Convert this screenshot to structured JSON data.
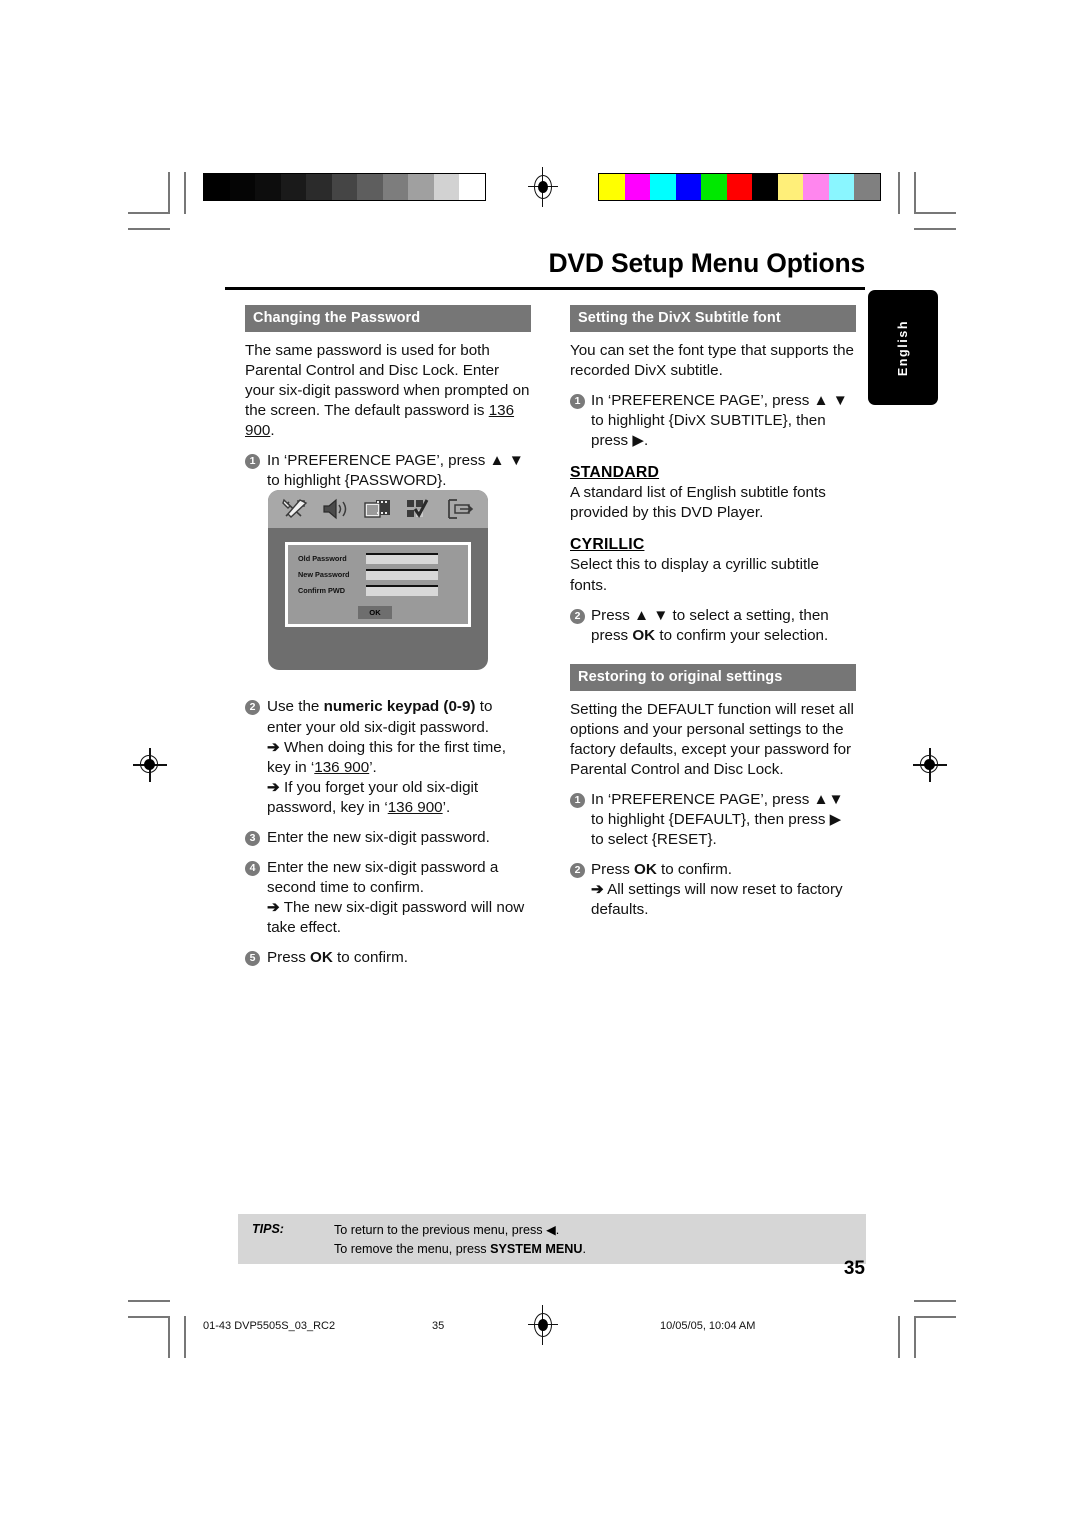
{
  "page": {
    "title": "DVD Setup Menu Options",
    "language_tab": "English",
    "page_number": "35"
  },
  "color_bars": {
    "grayscale": [
      "#000000",
      "#050505",
      "#0d0d0d",
      "#1a1a1a",
      "#2b2b2b",
      "#454545",
      "#5e5e5e",
      "#7d7d7d",
      "#a0a0a0",
      "#d2d2d2",
      "#ffffff"
    ],
    "colors": [
      "#ffff00",
      "#ff00ff",
      "#00ffff",
      "#0000ff",
      "#00e800",
      "#ff0000",
      "#000000",
      "#ffef79",
      "#ff86ee",
      "#8af6ff",
      "#808080"
    ]
  },
  "left_column": {
    "heading": "Changing the Password",
    "intro_1": "The same password is used for both Parental Control and Disc Lock.  Enter your six-digit password when prompted on the screen. The default password is ",
    "intro_password": "136 900",
    "intro_end": ".",
    "step1_num": "1",
    "step1_text": "In ‘PREFERENCE PAGE’, press ▲ ▼ to highlight {PASSWORD}.",
    "osd": {
      "icons": [
        "tools-icon",
        "speaker-icon",
        "video-icon",
        "preference-icon",
        "exit-icon"
      ],
      "rows": [
        {
          "label": "Old Password",
          "value": ""
        },
        {
          "label": "New Password",
          "value": ""
        },
        {
          "label": "Confirm PWD",
          "value": ""
        }
      ],
      "ok_label": "OK"
    },
    "step2_num": "2",
    "step2_a": "Use the ",
    "step2_b": "numeric keypad (0-9)",
    "step2_c": " to enter your old six-digit password.",
    "step2_sub1_a": "When doing this for the first time, key in ‘",
    "step2_sub1_pw": "136 900",
    "step2_sub1_b": "’.",
    "step2_sub2_a": "If you forget your old six-digit password, key in ‘",
    "step2_sub2_pw": "136 900",
    "step2_sub2_b": "’.",
    "step3_num": "3",
    "step3_text": "Enter the new six-digit password.",
    "step4_num": "4",
    "step4_text": "Enter the new six-digit password a second time to confirm.",
    "step4_sub": "The new six-digit password will now take effect.",
    "step5_num": "5",
    "step5_a": "Press ",
    "step5_b": "OK",
    "step5_c": " to confirm."
  },
  "right_column": {
    "heading_divx": "Setting the DivX Subtitle font",
    "divx_intro": "You can set the font type that supports the recorded DivX subtitle.",
    "divx_step1_num": "1",
    "divx_step1_text": "In ‘PREFERENCE PAGE’, press ▲ ▼ to highlight {DivX SUBTITLE}, then press ▶.",
    "standard_head": "STANDARD",
    "standard_body": "A standard list of English subtitle fonts provided by this DVD Player.",
    "cyrillic_head": "CYRILLIC",
    "cyrillic_body": "Select this to display a cyrillic subtitle fonts.",
    "divx_step2_num": "2",
    "divx_step2_a": "Press ▲ ▼ to select a setting, then press ",
    "divx_step2_b": "OK",
    "divx_step2_c": " to confirm your selection.",
    "heading_restore": "Restoring to original settings",
    "restore_intro": "Setting the DEFAULT function will reset all options and your personal settings to the factory defaults, except your password for Parental Control and Disc Lock.",
    "restore_step1_num": "1",
    "restore_step1_text": "In ‘PREFERENCE PAGE’, press ▲▼ to highlight {DEFAULT}, then press ▶  to select {RESET}.",
    "restore_step2_num": "2",
    "restore_step2_a": "Press ",
    "restore_step2_b": "OK",
    "restore_step2_c": " to confirm.",
    "restore_step2_sub": "All settings will now reset to factory defaults."
  },
  "tips": {
    "label": "TIPS:",
    "line1": "To return to the previous menu, press ◀.",
    "line2_a": "To remove the menu, press ",
    "line2_b": "SYSTEM MENU",
    "line2_c": "."
  },
  "footer": {
    "file": "01-43 DVP5505S_03_RC2",
    "page": "35",
    "timestamp": "10/05/05, 10:04 AM"
  }
}
